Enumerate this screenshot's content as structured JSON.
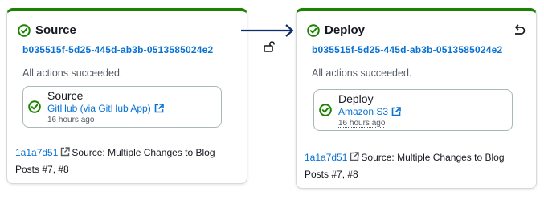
{
  "stages": [
    {
      "name": "Source",
      "execution_id": "b035515f-5d25-445d-ab3b-0513585024e2",
      "status": "All actions succeeded.",
      "action": {
        "name": "Source",
        "provider": "GitHub (via GitHub App)",
        "time": "16 hours ago"
      },
      "commit": {
        "id": "1a1a7d51",
        "message": "Source: Multiple Changes to Blog Posts #7, #8"
      }
    },
    {
      "name": "Deploy",
      "execution_id": "b035515f-5d25-445d-ab3b-0513585024e2",
      "status": "All actions succeeded.",
      "action": {
        "name": "Deploy",
        "provider": "Amazon S3",
        "time": "16 hours ago"
      },
      "commit": {
        "id": "1a1a7d51",
        "message": "Source: Multiple Changes to Blog Posts #7, #8"
      }
    }
  ],
  "icons": {
    "success": "check-circle-icon",
    "external": "external-link-icon",
    "retry": "undo-icon",
    "transition": "arrow-right-icon",
    "transition_lock": "unlock-icon"
  },
  "colors": {
    "success": "#1d8102",
    "link": "#0972d3",
    "arrow": "#0b2e6b"
  }
}
